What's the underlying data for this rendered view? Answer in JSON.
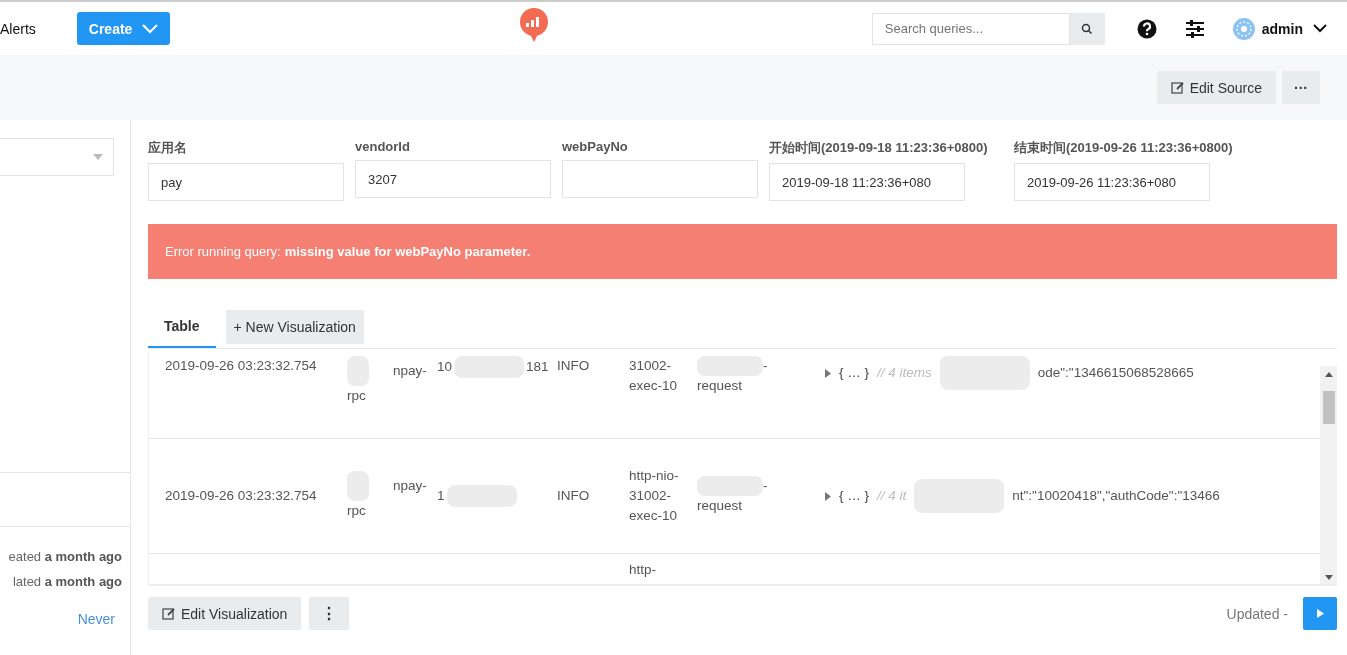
{
  "nav": {
    "alerts": "Alerts",
    "create": "Create",
    "search": {
      "placeholder": "Search queries..."
    },
    "user": "admin"
  },
  "toolbar": {
    "edit_source": "Edit Source",
    "more": "···"
  },
  "sidebar": {
    "meta": [
      {
        "prefix": "eated",
        "bold": "a month ago"
      },
      {
        "prefix": "lated",
        "bold": "a month ago"
      }
    ],
    "schedule": "Never"
  },
  "parameters": [
    {
      "label": "应用名",
      "value": "pay"
    },
    {
      "label": "vendorId",
      "value": "3207"
    },
    {
      "label": "webPayNo"
    },
    {
      "label": "开始时间(2019-09-18 11:23:36+0800)",
      "value": "2019-09-18 11:23:36+080"
    },
    {
      "label": "结束时间(2019-09-26 11:23:36+0800)",
      "value": "2019-09-26 11:23:36+080"
    }
  ],
  "error": {
    "prefix": "Error running query: ",
    "message": "missing value for webPayNo parameter."
  },
  "tabs": [
    {
      "label": "Table",
      "selected": true
    },
    {
      "label": "+ New Visualization",
      "selected": false
    }
  ],
  "table": {
    "rows": [
      {
        "time": "2019-09-26 03:23:32.754",
        "service": [
          "npay-",
          "rpc"
        ],
        "ip": [
          "10",
          "181"
        ],
        "level": "INFO",
        "thread": "31002-exec-10",
        "logger": [
          "-",
          "request"
        ],
        "summary": "{ … }",
        "count": "// 4 items",
        "message": "ode\":\"1346615068528665"
      },
      {
        "time": "2019-09-26 03:23:32.754",
        "service": [
          "npay-",
          "rpc"
        ],
        "ip": [
          "1"
        ],
        "level": "INFO",
        "thread": "http-nio-31002-exec-10",
        "logger": [
          "-",
          "request"
        ],
        "summary": "{ … }",
        "count": "// 4 it",
        "message": "nt\":\"10020418\",\"authCode\":\"13466"
      },
      {
        "thread": "http-"
      }
    ]
  },
  "footer": {
    "edit_visualization": "Edit Visualization",
    "more": "⋮",
    "updated": "Updated -"
  }
}
